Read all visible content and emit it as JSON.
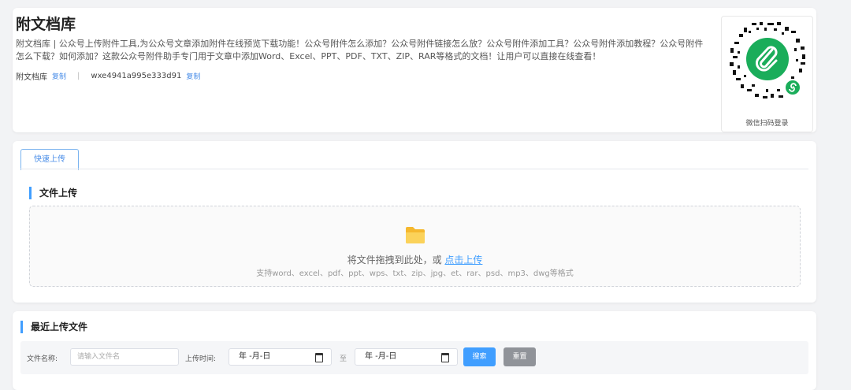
{
  "header": {
    "title": "附文档库",
    "description": "附文档库 | 公众号上传附件工具,为公众号文章添加附件在线预览下载功能！公众号附件怎么添加？公众号附件链接怎么放？公众号附件添加工具？公众号附件添加教程？公众号附件怎么下载？如何添加？这款公众号附件助手专门用于文章中添加Word、Excel、PPT、PDF、TXT、ZIP、RAR等格式的文档！让用户可以直接在线查看！",
    "name_label": "附文档库",
    "copy_label": "复制",
    "separator": "|",
    "app_id": "wxe4941a995e333d91",
    "copy_label_2": "复制",
    "qr_caption": "微信扫码登录"
  },
  "upload": {
    "tab_label": "快速上传",
    "section_title": "文件上传",
    "drop_text": "将文件拖拽到此处，或",
    "drop_link": "点击上传",
    "drop_sub": "支持word、excel、pdf、ppt、wps、txt、zip、jpg、et、rar、psd、mp3、dwg等格式"
  },
  "recent": {
    "section_title": "最近上传文件",
    "filename_label": "文件名称:",
    "filename_placeholder": "请输入文件名",
    "time_label": "上传时间:",
    "date_from": "年 -月-日",
    "date_sep": "至",
    "date_to": "年 -月-日",
    "search_button": "搜索",
    "reset_button": "重置"
  },
  "colors": {
    "accent": "#409eff",
    "qr_green": "#1aad5a",
    "folder": "#f7c33c"
  },
  "icons": {
    "qr": "wechat-miniprogram-qr-icon",
    "folder": "folder-icon",
    "calendar": "calendar-icon"
  }
}
